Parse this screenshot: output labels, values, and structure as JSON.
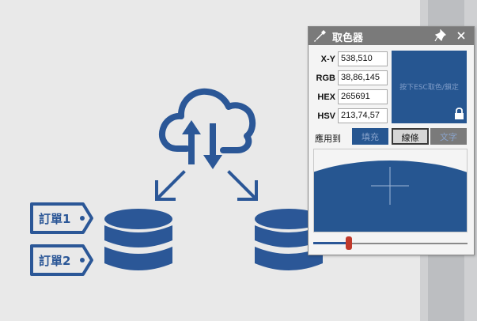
{
  "colors": {
    "accent": "#265691",
    "diagram": "#2b5797",
    "titlebar": "#7a7a7a"
  },
  "diagram": {
    "tags": [
      {
        "label": "訂單1"
      },
      {
        "label": "訂單2"
      }
    ],
    "icons": [
      "cloud-sync-icon",
      "arrow-down-left-icon",
      "arrow-down-right-icon",
      "database-icon",
      "database-icon"
    ]
  },
  "picker": {
    "title": "取色器",
    "rows": [
      {
        "label": "X-Y",
        "value": "538,510"
      },
      {
        "label": "RGB",
        "value": "38,86,145"
      },
      {
        "label": "HEX",
        "value": "265691"
      },
      {
        "label": "HSV",
        "value": "213,74,57"
      }
    ],
    "swatch_color": "#265691",
    "swatch_hint": "按下ESC取色/鎖定",
    "apply_label": "應用到",
    "buttons": {
      "fill": "填充",
      "line": "線條",
      "text": "文字"
    },
    "slider_level": 0.23
  }
}
